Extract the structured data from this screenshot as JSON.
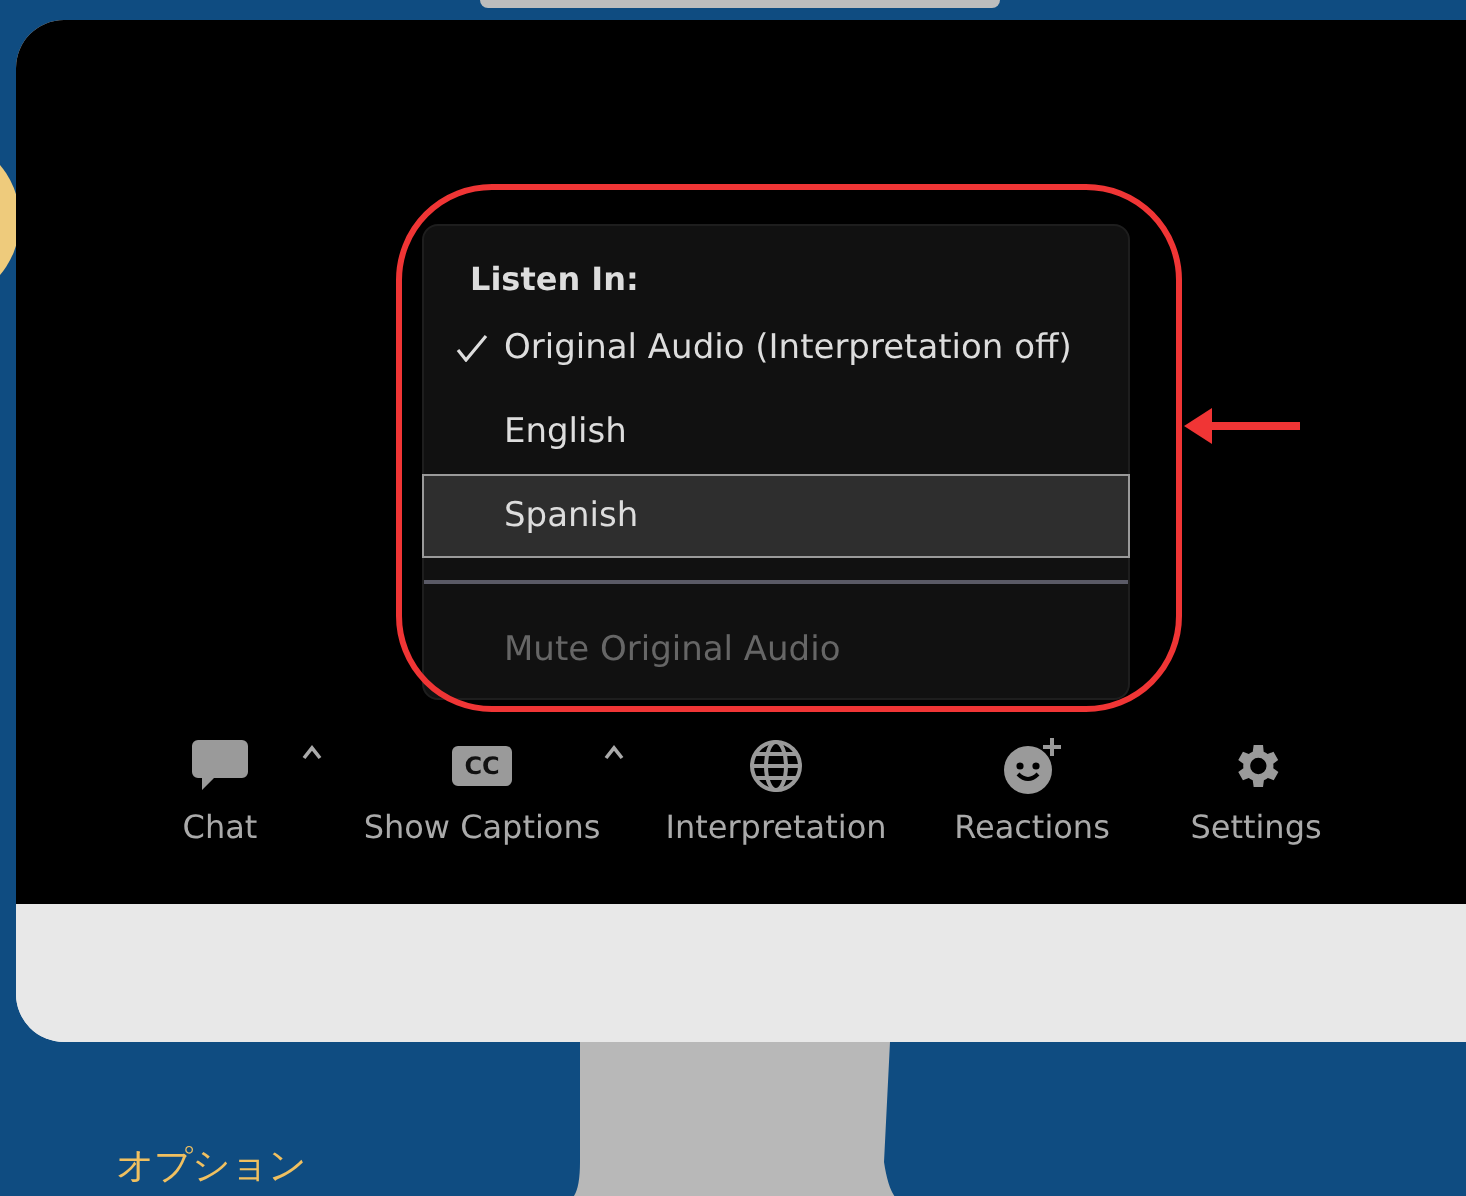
{
  "menu": {
    "title": "Listen In:",
    "items": [
      {
        "label": "Original Audio (Interpretation off)",
        "checked": true,
        "selected": false,
        "disabled": false
      },
      {
        "label": "English",
        "checked": false,
        "selected": false,
        "disabled": false
      },
      {
        "label": "Spanish",
        "checked": false,
        "selected": true,
        "disabled": false
      }
    ],
    "footer_item": {
      "label": "Mute Original Audio",
      "disabled": true
    }
  },
  "toolbar": [
    {
      "label": "Chat",
      "has_menu": true
    },
    {
      "label": "Show Captions",
      "badge": "CC",
      "has_menu": true
    },
    {
      "label": "Interpretation",
      "has_menu": false
    },
    {
      "label": "Reactions",
      "has_menu": false
    },
    {
      "label": "Settings",
      "has_menu": false
    }
  ],
  "caption": "オプション"
}
